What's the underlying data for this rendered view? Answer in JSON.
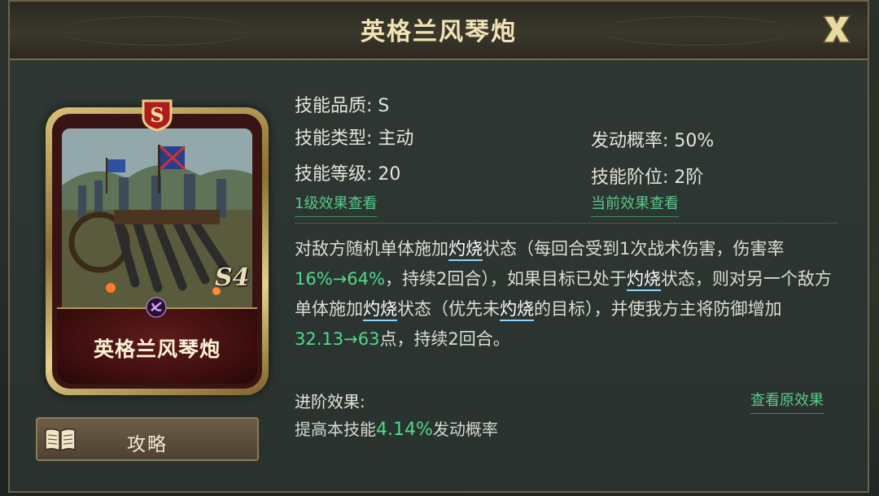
{
  "dialog": {
    "title": "英格兰风琴炮",
    "close_label": "X"
  },
  "card": {
    "quality": "S",
    "name": "英格兰风琴炮",
    "level_mark": "S4",
    "faction_icon": "faction-emblem-icon"
  },
  "guide_button": {
    "label": "攻略",
    "icon": "book-icon"
  },
  "skill": {
    "quality": "技能品质: S",
    "type": "技能类型: 主动",
    "level": "技能等级: 20",
    "trigger_rate": "发动概率: 50%",
    "tier": "技能阶位: 2阶",
    "view_level1": "1级效果查看",
    "view_current": "当前效果查看"
  },
  "description": {
    "p1": "对敌方随机单体施加",
    "kw1": "灼烧",
    "p2": "状态（每回合受到1次战术伤害，伤害率",
    "n1": "16%→64%",
    "p3": "，持续2回合），如果目标已处于",
    "kw2": "灼烧",
    "p4": "状态，则对另一个敌方单体施加",
    "kw3": "灼烧",
    "p5": "状态（优先未",
    "kw4": "灼烧",
    "p6": "的目标），并使我方主将防御增加",
    "n2": "32.13→63",
    "p7": "点，持续2回合。"
  },
  "advanced": {
    "title": "进阶效果:",
    "view_original": "查看原效果",
    "text_before": "提高本技能",
    "value": "4.14%",
    "text_after": "发动概率"
  },
  "colors": {
    "highlight_number": "#53d98a",
    "keyword_underline": "#8fd3ff",
    "link_green": "#59c98a",
    "title_gold": "#f1e3b5"
  }
}
